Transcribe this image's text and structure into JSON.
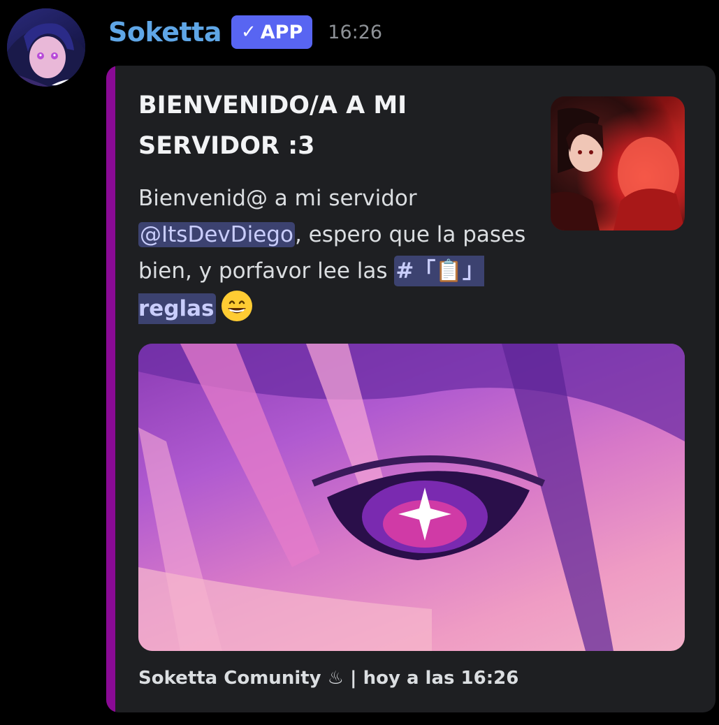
{
  "message": {
    "username": "Soketta",
    "badge_check": "✓",
    "badge_label": "APP",
    "timestamp": "16:26",
    "avatar_icon": "avatar"
  },
  "embed": {
    "accent_color": "#8a0a95",
    "title": "BIENVENIDO/A A MI SERVIDOR :3",
    "description_pre": "Bienvenid@ a mi servidor ",
    "mention": "@ItsDevDiego",
    "description_mid": ", espero que la pases bien, y porfavor lee las ",
    "channel": "#「📋」reglas",
    "emoji_icon": "grinning-face-emoji",
    "thumbnail_icon": "thumbnail",
    "image_icon": "embed-image",
    "footer": "Soketta Comunity ♨ | hoy a las 16:26"
  }
}
